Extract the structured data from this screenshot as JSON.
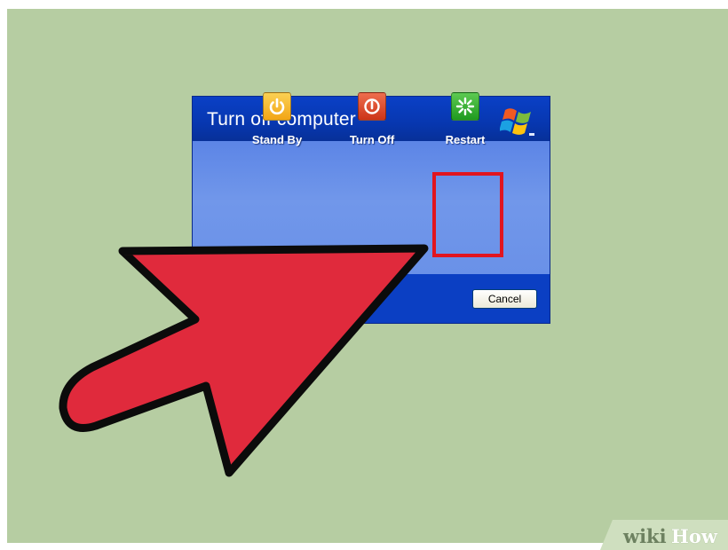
{
  "dialog": {
    "title": "Turn off computer",
    "options": [
      {
        "id": "standby",
        "label": "Stand By",
        "icon": "power-icon",
        "color": "#f2a516"
      },
      {
        "id": "turnoff",
        "label": "Turn Off",
        "icon": "power-off-icon",
        "color": "#cc3418"
      },
      {
        "id": "restart",
        "label": "Restart",
        "icon": "restart-icon",
        "color": "#1f9a1f"
      }
    ],
    "cancel_label": "Cancel",
    "logo_icon": "windows-xp-logo-icon"
  },
  "overlay": {
    "highlight_color": "#e1151f",
    "arrow_color": "#e02a3c",
    "highlighted_option": "restart"
  },
  "watermark": {
    "part1": "wiki",
    "part2": "How"
  },
  "colors": {
    "background": "#b6cda2",
    "titlebar": "#0a40c6",
    "dialog_body": "#6a91e8",
    "footer": "#0b3fc3"
  }
}
